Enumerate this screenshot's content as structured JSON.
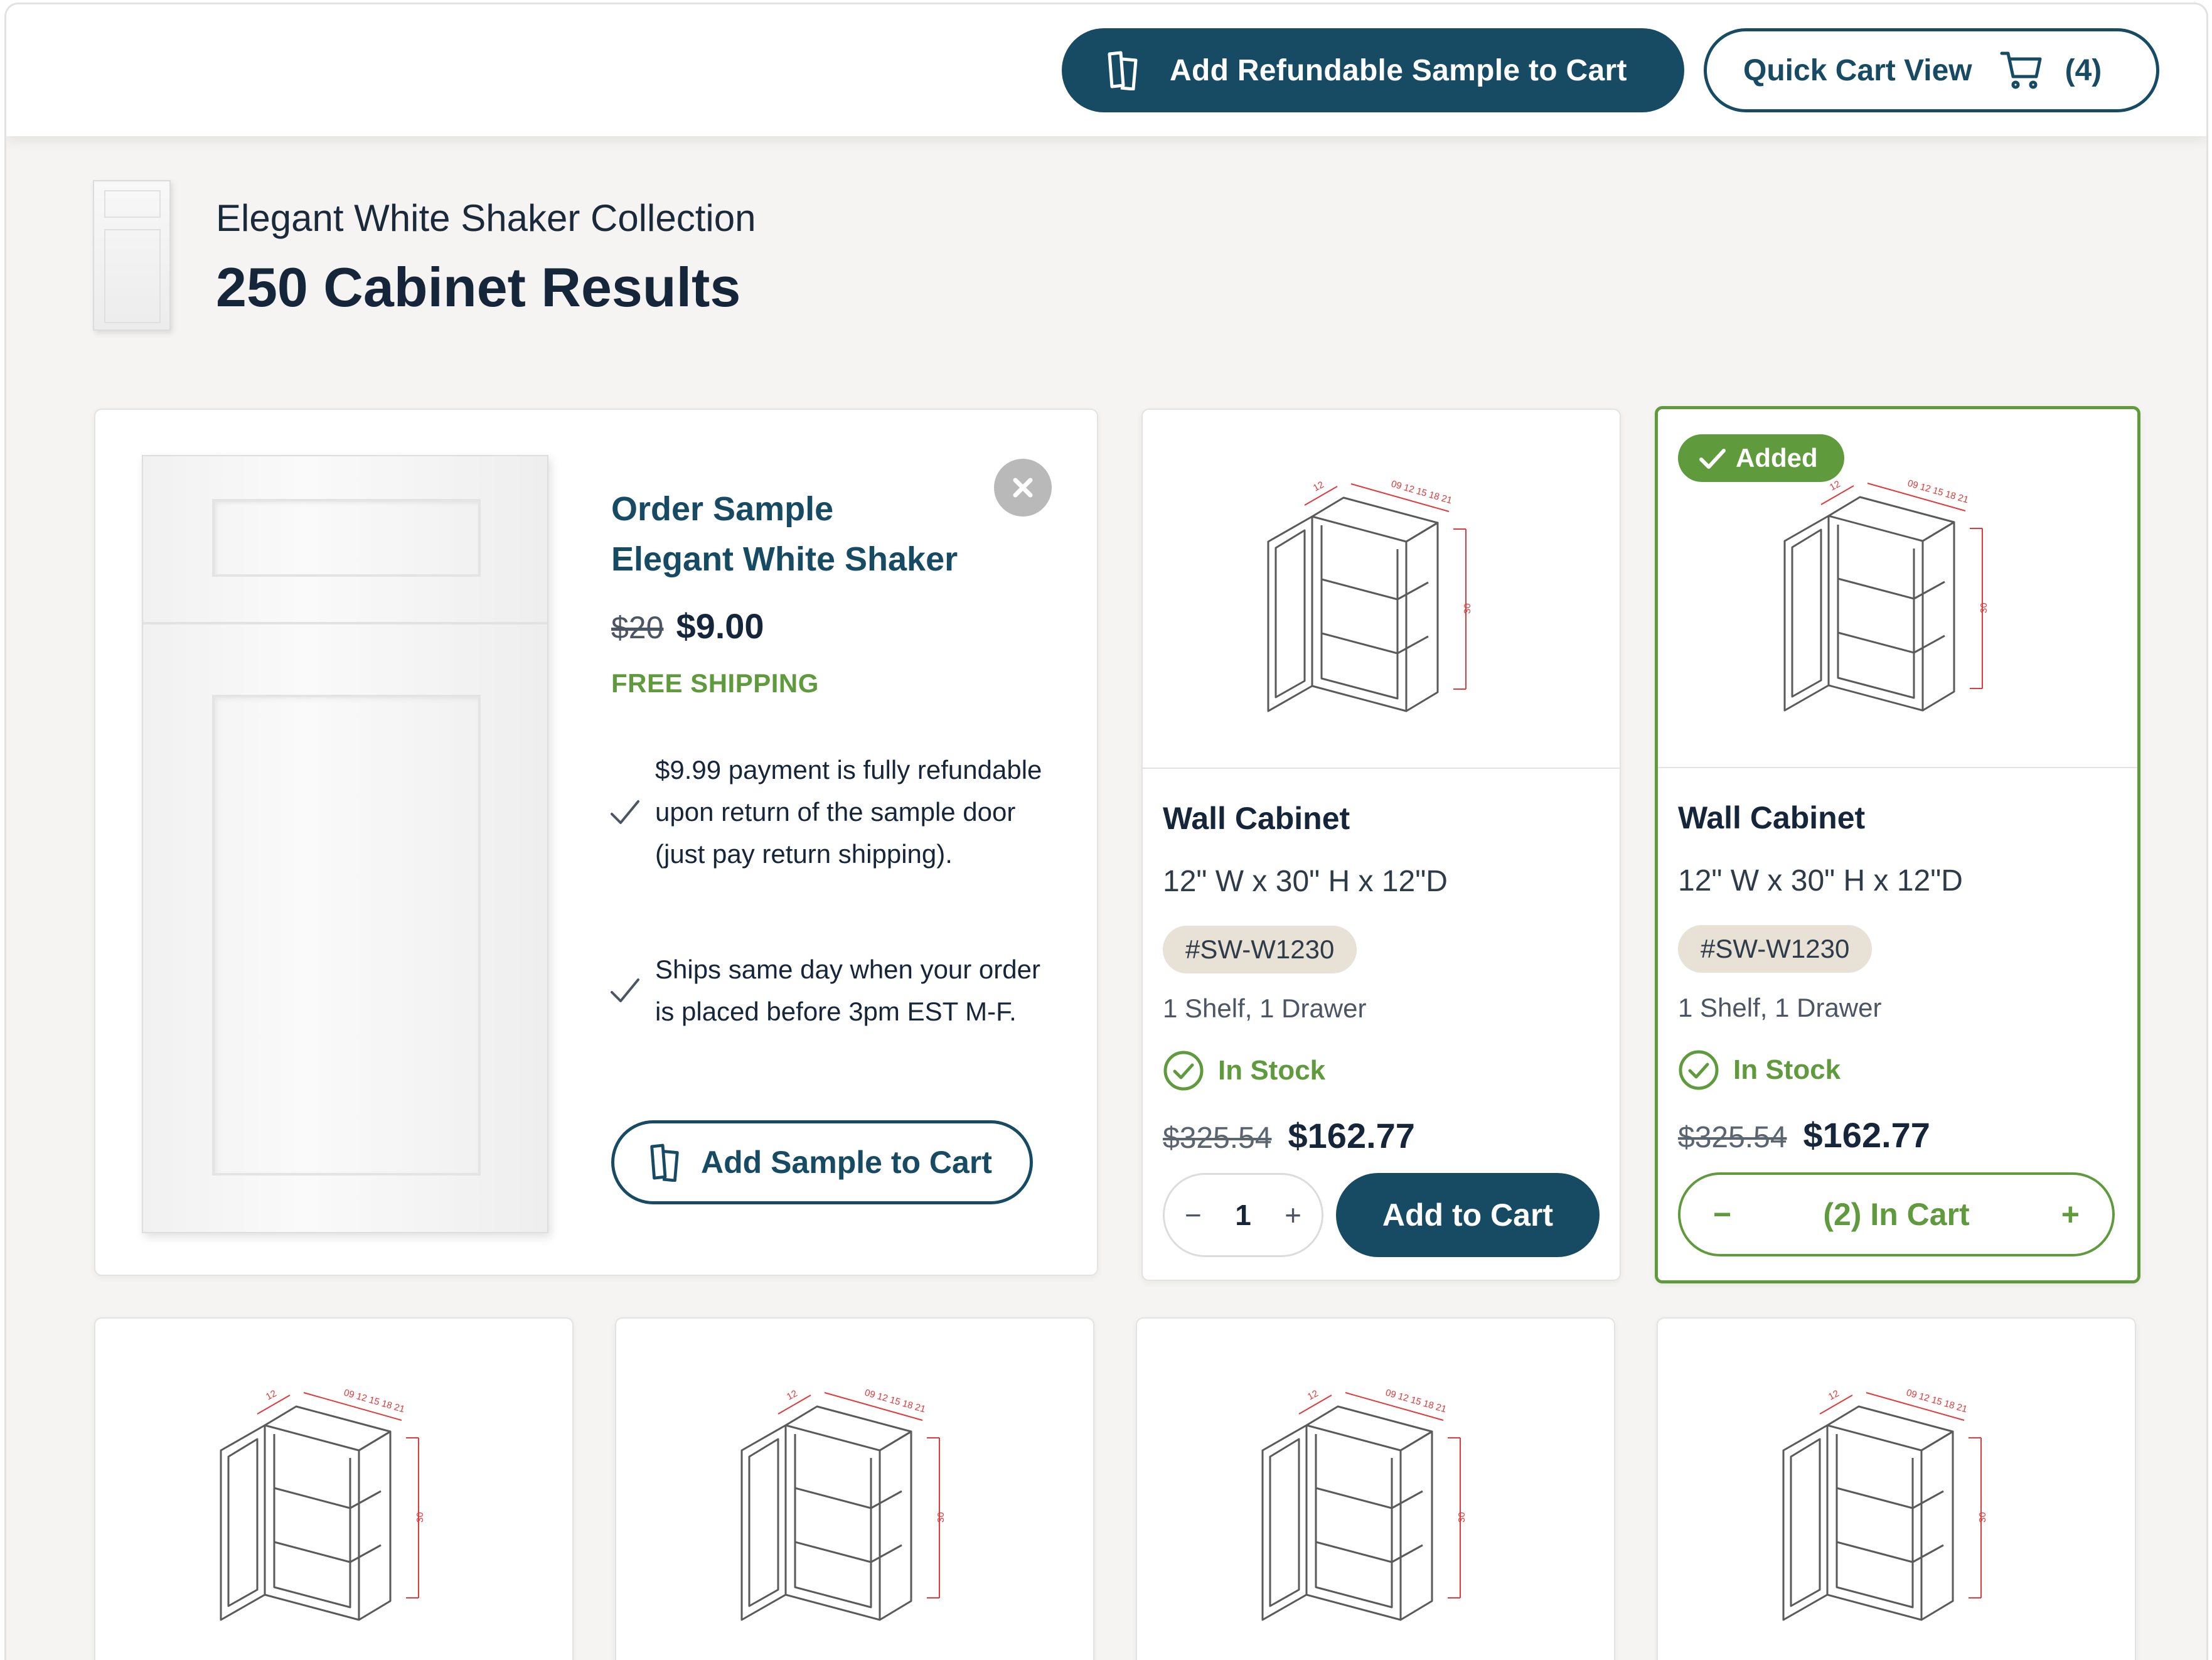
{
  "topbar": {
    "sample_button_label": "Add Refundable Sample to Cart",
    "quick_cart_label": "Quick Cart View",
    "cart_count": "(4)"
  },
  "header": {
    "collection_name": "Elegant White Shaker Collection",
    "results_title": "250 Cabinet Results"
  },
  "sample_card": {
    "title_line1": "Order Sample",
    "title_line2": "Elegant White Shaker",
    "old_price": "$20",
    "new_price": "$9.00",
    "shipping": "FREE SHIPPING",
    "bullets": [
      "$9.99 payment is fully refundable upon return of the sample door (just pay return shipping).",
      "Ships same day when your order is placed before 3pm EST M-F."
    ],
    "add_button_label": "Add Sample to Cart"
  },
  "products": [
    {
      "title": "Wall Cabinet",
      "dimensions": "12\" W x 30\" H x 12\"D",
      "sku": "#SW-W1230",
      "description": "1 Shelf, 1 Drawer",
      "stock": "In Stock",
      "old_price": "$325.54",
      "new_price": "$162.77",
      "quantity": "1",
      "qty_minus": "−",
      "qty_plus": "+",
      "button_label": "Add to Cart"
    },
    {
      "badge": "Added",
      "title": "Wall Cabinet",
      "dimensions": "12\" W x 30\" H x 12\"D",
      "sku": "#SW-W1230",
      "description": "1 Shelf, 1 Drawer",
      "stock": "In Stock",
      "old_price": "$325.54",
      "new_price": "$162.77",
      "in_cart_label": "(2) In Cart",
      "qty_minus": "−",
      "qty_plus": "+"
    }
  ],
  "icons": {
    "sample": "sample-door-icon",
    "cart": "cart-icon",
    "close": "close-icon",
    "check": "check-icon",
    "stock": "check-circle-icon"
  },
  "colors": {
    "primary": "#174a63",
    "success": "#5f9a3d",
    "sku_bg": "#e8e1d5",
    "background": "#f5f4f2"
  }
}
